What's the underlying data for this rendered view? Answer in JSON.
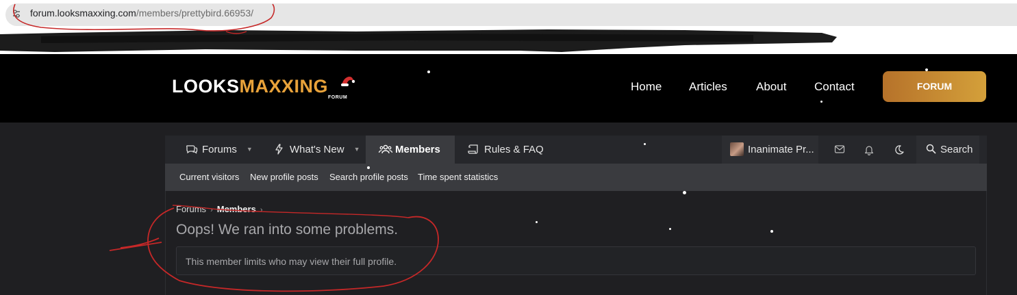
{
  "browser": {
    "url_domain": "forum.looksmaxxing.com",
    "url_path": "/members/prettybird.66953/",
    "site_info_icon": "tune-icon"
  },
  "header": {
    "logo_main_white": "LOOKS",
    "logo_main_accent": "MAXXING",
    "logo_sub": "FORUM",
    "links": [
      "Home",
      "Articles",
      "About",
      "Contact"
    ],
    "cta_label": "FORUM",
    "accent_color": "#e8a23a"
  },
  "navbar": {
    "tabs": [
      {
        "label": "Forums",
        "icon": "chat-bubbles-icon",
        "has_dropdown": true
      },
      {
        "label": "What's New",
        "icon": "bolt-icon",
        "has_dropdown": true
      },
      {
        "label": "Members",
        "icon": "users-icon",
        "active": true
      },
      {
        "label": "Rules & FAQ",
        "icon": "scroll-icon"
      }
    ],
    "username": "Inanimate Pr...",
    "search_label": "Search"
  },
  "subnav": {
    "links": [
      "Current visitors",
      "New profile posts",
      "Search profile posts",
      "Time spent statistics"
    ]
  },
  "breadcrumb": {
    "items": [
      "Forums",
      "Members"
    ]
  },
  "error": {
    "title": "Oops! We ran into some problems.",
    "message": "This member limits who may view their full profile."
  }
}
